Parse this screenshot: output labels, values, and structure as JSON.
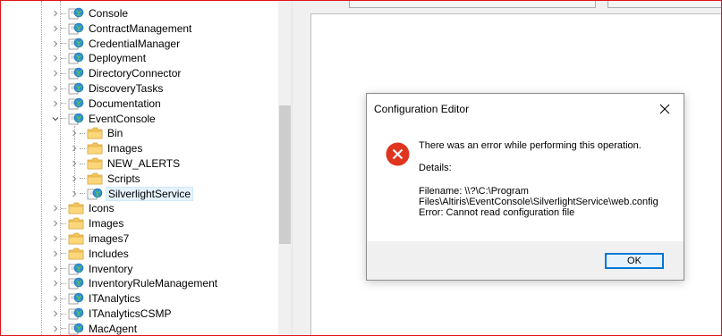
{
  "tree": {
    "items": [
      {
        "label": "Console",
        "icon": "globe-web-icon",
        "expander": "collapsed",
        "level": 0
      },
      {
        "label": "ContractManagement",
        "icon": "globe-web-icon",
        "expander": "collapsed",
        "level": 0
      },
      {
        "label": "CredentialManager",
        "icon": "globe-web-icon",
        "expander": "collapsed",
        "level": 0
      },
      {
        "label": "Deployment",
        "icon": "globe-web-icon",
        "expander": "collapsed",
        "level": 0
      },
      {
        "label": "DirectoryConnector",
        "icon": "globe-web-icon",
        "expander": "collapsed",
        "level": 0
      },
      {
        "label": "DiscoveryTasks",
        "icon": "globe-web-icon",
        "expander": "collapsed",
        "level": 0
      },
      {
        "label": "Documentation",
        "icon": "globe-web-icon",
        "expander": "collapsed",
        "level": 0
      },
      {
        "label": "EventConsole",
        "icon": "globe-web-icon",
        "expander": "expanded",
        "level": 0
      },
      {
        "label": "Bin",
        "icon": "folder-icon",
        "expander": "collapsed",
        "level": 1
      },
      {
        "label": "Images",
        "icon": "folder-icon",
        "expander": "collapsed",
        "level": 1
      },
      {
        "label": "NEW_ALERTS",
        "icon": "folder-icon",
        "expander": "collapsed",
        "level": 1
      },
      {
        "label": "Scripts",
        "icon": "folder-icon",
        "expander": "collapsed",
        "level": 1
      },
      {
        "label": "SilverlightService",
        "icon": "globe-web-icon",
        "expander": "collapsed",
        "level": 1,
        "selected": true
      },
      {
        "label": "Icons",
        "icon": "folder-icon",
        "expander": "collapsed",
        "level": 0
      },
      {
        "label": "Images",
        "icon": "folder-icon",
        "expander": "collapsed",
        "level": 0
      },
      {
        "label": "images7",
        "icon": "folder-icon",
        "expander": "collapsed",
        "level": 0
      },
      {
        "label": "Includes",
        "icon": "folder-icon",
        "expander": "collapsed",
        "level": 0
      },
      {
        "label": "Inventory",
        "icon": "globe-web-icon",
        "expander": "collapsed",
        "level": 0
      },
      {
        "label": "InventoryRuleManagement",
        "icon": "globe-web-icon",
        "expander": "collapsed",
        "level": 0
      },
      {
        "label": "ITAnalytics",
        "icon": "globe-web-icon",
        "expander": "collapsed",
        "level": 0
      },
      {
        "label": "ITAnalyticsCSMP",
        "icon": "globe-web-icon",
        "expander": "collapsed",
        "level": 0
      },
      {
        "label": "MacAgent",
        "icon": "globe-web-icon",
        "expander": "collapsed",
        "level": 0
      }
    ]
  },
  "dialog": {
    "title": "Configuration Editor",
    "message": "There was an error while performing this operation.",
    "details_label": "Details:",
    "filename_line1": "Filename: \\\\?\\C:\\Program",
    "filename_line2": "Files\\Altiris\\EventConsole\\SilverlightService\\web.config",
    "error_line": "Error: Cannot read configuration file",
    "ok_label": "OK",
    "close_icon": "close-x-icon",
    "error_icon": "error-circle-icon"
  },
  "colors": {
    "error_red": "#e0341e",
    "accent_blue": "#0078d7",
    "folder_yellow": "#f4c55c",
    "selection_bg": "#e5f3ff",
    "frame_border": "#e0131a"
  }
}
